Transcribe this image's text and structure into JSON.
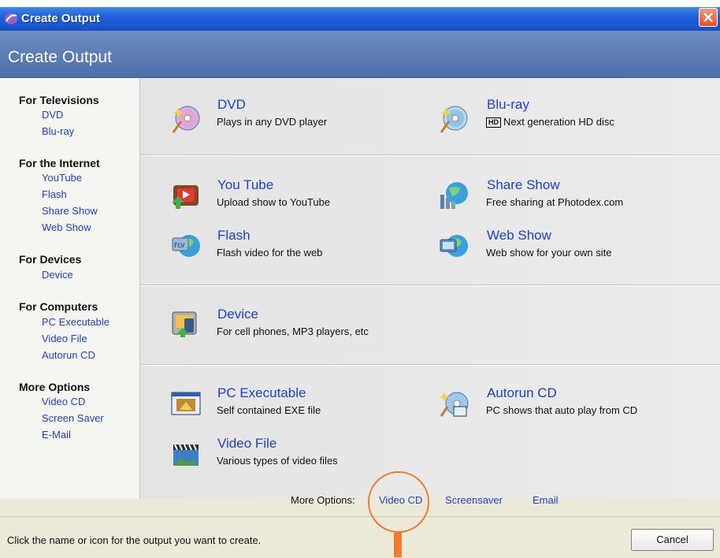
{
  "window": {
    "title": "Create Output",
    "header": "Create Output"
  },
  "sidebar": {
    "groups": [
      {
        "heading": "For Televisions",
        "items": [
          "DVD",
          "Blu-ray"
        ]
      },
      {
        "heading": "For the Internet",
        "items": [
          "YouTube",
          "Flash",
          "Share Show",
          "Web Show"
        ]
      },
      {
        "heading": "For Devices",
        "items": [
          "Device"
        ]
      },
      {
        "heading": "For Computers",
        "items": [
          "PC Executable",
          "Video File",
          "Autorun CD"
        ]
      },
      {
        "heading": "More Options",
        "items": [
          "Video CD",
          "Screen Saver",
          "E-Mail"
        ]
      }
    ]
  },
  "options": {
    "dvd": {
      "title": "DVD",
      "desc": "Plays in any DVD player",
      "icon": "dvd-disc-icon"
    },
    "bluray": {
      "title": "Blu-ray",
      "badge": "HD",
      "desc": "Next generation HD disc",
      "icon": "bluray-disc-icon"
    },
    "youtube": {
      "title": "You Tube",
      "desc": "Upload show to YouTube",
      "icon": "youtube-tv-icon"
    },
    "shareshow": {
      "title": "Share Show",
      "desc": "Free sharing at Photodex.com",
      "icon": "share-show-icon"
    },
    "flash": {
      "title": "Flash",
      "desc": "Flash video for the web",
      "icon": "flash-video-icon"
    },
    "webshow": {
      "title": "Web Show",
      "desc": "Web show for your own site",
      "icon": "web-show-icon"
    },
    "device": {
      "title": "Device",
      "desc": "For cell phones, MP3 players, etc",
      "icon": "device-icon"
    },
    "pcexe": {
      "title": "PC Executable",
      "desc": "Self contained EXE file",
      "icon": "pc-executable-icon"
    },
    "autorun": {
      "title": "Autorun CD",
      "desc": "PC shows that auto play from CD",
      "icon": "autorun-cd-icon"
    },
    "videofile": {
      "title": "Video File",
      "desc": "Various types of video files",
      "icon": "video-file-icon"
    }
  },
  "more_options": {
    "label": "More Options:",
    "links": [
      "Video CD",
      "Screensaver",
      "Email"
    ]
  },
  "status": {
    "text": "Click the name or icon for the output you want to create.",
    "cancel_label": "Cancel"
  },
  "colors": {
    "link": "#1e3fd0",
    "titlebar": "#1f5fd8",
    "callout": "#ef7d2b"
  }
}
